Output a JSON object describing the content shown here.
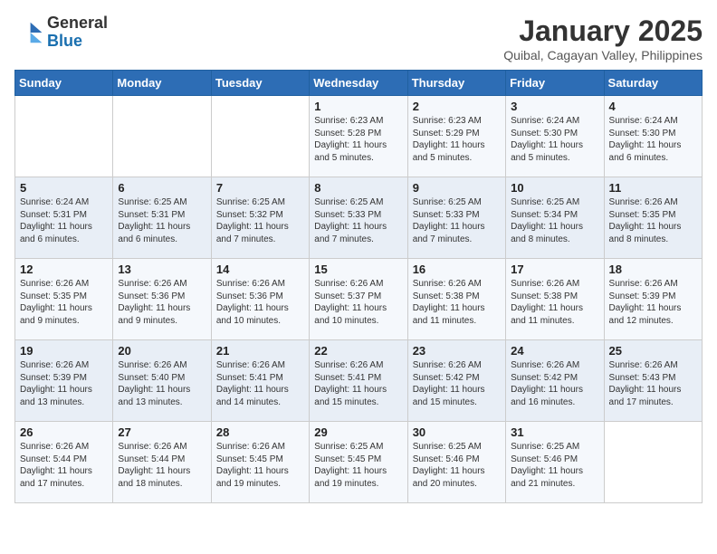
{
  "header": {
    "logo_general": "General",
    "logo_blue": "Blue",
    "month_title": "January 2025",
    "subtitle": "Quibal, Cagayan Valley, Philippines"
  },
  "weekdays": [
    "Sunday",
    "Monday",
    "Tuesday",
    "Wednesday",
    "Thursday",
    "Friday",
    "Saturday"
  ],
  "weeks": [
    [
      {
        "day": "",
        "sunrise": "",
        "sunset": "",
        "daylight": ""
      },
      {
        "day": "",
        "sunrise": "",
        "sunset": "",
        "daylight": ""
      },
      {
        "day": "",
        "sunrise": "",
        "sunset": "",
        "daylight": ""
      },
      {
        "day": "1",
        "sunrise": "Sunrise: 6:23 AM",
        "sunset": "Sunset: 5:28 PM",
        "daylight": "Daylight: 11 hours and 5 minutes."
      },
      {
        "day": "2",
        "sunrise": "Sunrise: 6:23 AM",
        "sunset": "Sunset: 5:29 PM",
        "daylight": "Daylight: 11 hours and 5 minutes."
      },
      {
        "day": "3",
        "sunrise": "Sunrise: 6:24 AM",
        "sunset": "Sunset: 5:30 PM",
        "daylight": "Daylight: 11 hours and 5 minutes."
      },
      {
        "day": "4",
        "sunrise": "Sunrise: 6:24 AM",
        "sunset": "Sunset: 5:30 PM",
        "daylight": "Daylight: 11 hours and 6 minutes."
      }
    ],
    [
      {
        "day": "5",
        "sunrise": "Sunrise: 6:24 AM",
        "sunset": "Sunset: 5:31 PM",
        "daylight": "Daylight: 11 hours and 6 minutes."
      },
      {
        "day": "6",
        "sunrise": "Sunrise: 6:25 AM",
        "sunset": "Sunset: 5:31 PM",
        "daylight": "Daylight: 11 hours and 6 minutes."
      },
      {
        "day": "7",
        "sunrise": "Sunrise: 6:25 AM",
        "sunset": "Sunset: 5:32 PM",
        "daylight": "Daylight: 11 hours and 7 minutes."
      },
      {
        "day": "8",
        "sunrise": "Sunrise: 6:25 AM",
        "sunset": "Sunset: 5:33 PM",
        "daylight": "Daylight: 11 hours and 7 minutes."
      },
      {
        "day": "9",
        "sunrise": "Sunrise: 6:25 AM",
        "sunset": "Sunset: 5:33 PM",
        "daylight": "Daylight: 11 hours and 7 minutes."
      },
      {
        "day": "10",
        "sunrise": "Sunrise: 6:25 AM",
        "sunset": "Sunset: 5:34 PM",
        "daylight": "Daylight: 11 hours and 8 minutes."
      },
      {
        "day": "11",
        "sunrise": "Sunrise: 6:26 AM",
        "sunset": "Sunset: 5:35 PM",
        "daylight": "Daylight: 11 hours and 8 minutes."
      }
    ],
    [
      {
        "day": "12",
        "sunrise": "Sunrise: 6:26 AM",
        "sunset": "Sunset: 5:35 PM",
        "daylight": "Daylight: 11 hours and 9 minutes."
      },
      {
        "day": "13",
        "sunrise": "Sunrise: 6:26 AM",
        "sunset": "Sunset: 5:36 PM",
        "daylight": "Daylight: 11 hours and 9 minutes."
      },
      {
        "day": "14",
        "sunrise": "Sunrise: 6:26 AM",
        "sunset": "Sunset: 5:36 PM",
        "daylight": "Daylight: 11 hours and 10 minutes."
      },
      {
        "day": "15",
        "sunrise": "Sunrise: 6:26 AM",
        "sunset": "Sunset: 5:37 PM",
        "daylight": "Daylight: 11 hours and 10 minutes."
      },
      {
        "day": "16",
        "sunrise": "Sunrise: 6:26 AM",
        "sunset": "Sunset: 5:38 PM",
        "daylight": "Daylight: 11 hours and 11 minutes."
      },
      {
        "day": "17",
        "sunrise": "Sunrise: 6:26 AM",
        "sunset": "Sunset: 5:38 PM",
        "daylight": "Daylight: 11 hours and 11 minutes."
      },
      {
        "day": "18",
        "sunrise": "Sunrise: 6:26 AM",
        "sunset": "Sunset: 5:39 PM",
        "daylight": "Daylight: 11 hours and 12 minutes."
      }
    ],
    [
      {
        "day": "19",
        "sunrise": "Sunrise: 6:26 AM",
        "sunset": "Sunset: 5:39 PM",
        "daylight": "Daylight: 11 hours and 13 minutes."
      },
      {
        "day": "20",
        "sunrise": "Sunrise: 6:26 AM",
        "sunset": "Sunset: 5:40 PM",
        "daylight": "Daylight: 11 hours and 13 minutes."
      },
      {
        "day": "21",
        "sunrise": "Sunrise: 6:26 AM",
        "sunset": "Sunset: 5:41 PM",
        "daylight": "Daylight: 11 hours and 14 minutes."
      },
      {
        "day": "22",
        "sunrise": "Sunrise: 6:26 AM",
        "sunset": "Sunset: 5:41 PM",
        "daylight": "Daylight: 11 hours and 15 minutes."
      },
      {
        "day": "23",
        "sunrise": "Sunrise: 6:26 AM",
        "sunset": "Sunset: 5:42 PM",
        "daylight": "Daylight: 11 hours and 15 minutes."
      },
      {
        "day": "24",
        "sunrise": "Sunrise: 6:26 AM",
        "sunset": "Sunset: 5:42 PM",
        "daylight": "Daylight: 11 hours and 16 minutes."
      },
      {
        "day": "25",
        "sunrise": "Sunrise: 6:26 AM",
        "sunset": "Sunset: 5:43 PM",
        "daylight": "Daylight: 11 hours and 17 minutes."
      }
    ],
    [
      {
        "day": "26",
        "sunrise": "Sunrise: 6:26 AM",
        "sunset": "Sunset: 5:44 PM",
        "daylight": "Daylight: 11 hours and 17 minutes."
      },
      {
        "day": "27",
        "sunrise": "Sunrise: 6:26 AM",
        "sunset": "Sunset: 5:44 PM",
        "daylight": "Daylight: 11 hours and 18 minutes."
      },
      {
        "day": "28",
        "sunrise": "Sunrise: 6:26 AM",
        "sunset": "Sunset: 5:45 PM",
        "daylight": "Daylight: 11 hours and 19 minutes."
      },
      {
        "day": "29",
        "sunrise": "Sunrise: 6:25 AM",
        "sunset": "Sunset: 5:45 PM",
        "daylight": "Daylight: 11 hours and 19 minutes."
      },
      {
        "day": "30",
        "sunrise": "Sunrise: 6:25 AM",
        "sunset": "Sunset: 5:46 PM",
        "daylight": "Daylight: 11 hours and 20 minutes."
      },
      {
        "day": "31",
        "sunrise": "Sunrise: 6:25 AM",
        "sunset": "Sunset: 5:46 PM",
        "daylight": "Daylight: 11 hours and 21 minutes."
      },
      {
        "day": "",
        "sunrise": "",
        "sunset": "",
        "daylight": ""
      }
    ]
  ]
}
